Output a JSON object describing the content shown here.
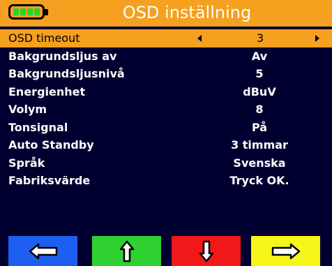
{
  "header": {
    "title": "OSD inställning",
    "battery_cells": 4
  },
  "menu": {
    "items": [
      {
        "label": "OSD timeout",
        "value": "3",
        "selected": true
      },
      {
        "label": "Bakgrundsljus av",
        "value": "Av"
      },
      {
        "label": "Bakgrundsljusnivå",
        "value": "5"
      },
      {
        "label": "Energienhet",
        "value": "dBuV"
      },
      {
        "label": "Volym",
        "value": "8"
      },
      {
        "label": "Tonsignal",
        "value": "På"
      },
      {
        "label": "Auto Standby",
        "value": "3 timmar"
      },
      {
        "label": "Språk",
        "value": "Svenska"
      },
      {
        "label": "Fabriksvärde",
        "value": "Tryck OK."
      }
    ]
  },
  "softkeys": [
    {
      "icon": "arrow-left-icon",
      "color": "#1e5ef0"
    },
    {
      "icon": "arrow-up-icon",
      "color": "#2fd02f"
    },
    {
      "icon": "arrow-down-icon",
      "color": "#f01818"
    },
    {
      "icon": "arrow-right-icon",
      "color": "#f5f518"
    }
  ],
  "colors": {
    "accent": "#f5a01e",
    "background": "#000030"
  }
}
